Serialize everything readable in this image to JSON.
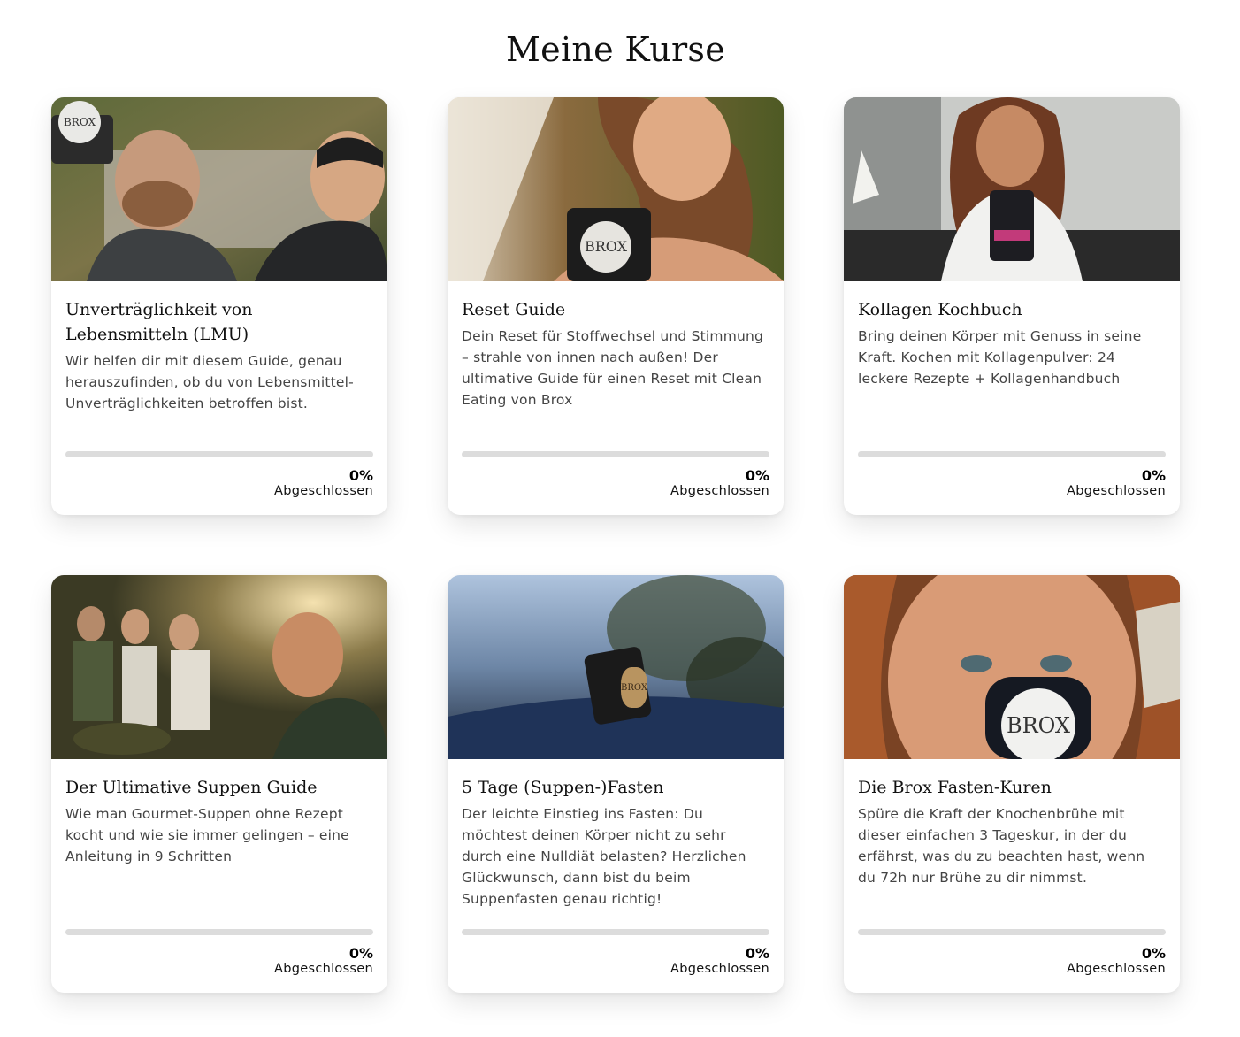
{
  "page": {
    "title": "Meine Kurse"
  },
  "courses": [
    {
      "title": "Unverträglichkeit von Lebensmitteln (LMU)",
      "description": "Wir helfen dir mit diesem Guide, genau herauszufinden, ob du von Lebensmittel-Unverträglichkeiten betroffen bist.",
      "progress": 0,
      "progress_label": "0%",
      "status_label": "Abgeschlossen"
    },
    {
      "title": "Reset Guide",
      "description": "Dein Reset für Stoffwechsel und Stimmung – strahle von innen nach außen! Der ultimative Guide für einen Reset mit Clean Eating von Brox",
      "progress": 0,
      "progress_label": "0%",
      "status_label": "Abgeschlossen"
    },
    {
      "title": "Kollagen Kochbuch",
      "description": "Bring deinen Körper mit Genuss in seine Kraft. Kochen mit Kollagenpulver: 24 leckere Rezepte + Kollagenhandbuch",
      "progress": 0,
      "progress_label": "0%",
      "status_label": "Abgeschlossen"
    },
    {
      "title": "Der Ultimative Suppen Guide",
      "description": "Wie man Gourmet-Suppen ohne Rezept kocht und wie sie immer gelingen – eine Anleitung in 9 Schritten",
      "progress": 0,
      "progress_label": "0%",
      "status_label": "Abgeschlossen"
    },
    {
      "title": "5 Tage (Suppen-)Fasten",
      "description": "Der leichte Einstieg ins Fasten: Du möchtest deinen Körper nicht zu sehr durch eine Nulldiät belasten? Herzlichen Glückwunsch, dann bist du beim Suppenfasten genau richtig!",
      "progress": 0,
      "progress_label": "0%",
      "status_label": "Abgeschlossen"
    },
    {
      "title": "Die Brox Fasten-Kuren",
      "description": "Spüre die Kraft der Knochenbrühe mit dieser einfachen 3 Tageskur, in der du erfährst, was du zu beachten hast, wenn du 72h nur Brühe zu dir nimmst.",
      "progress": 0,
      "progress_label": "0%",
      "status_label": "Abgeschlossen"
    }
  ],
  "logo": {
    "mug_text": "BROX"
  }
}
